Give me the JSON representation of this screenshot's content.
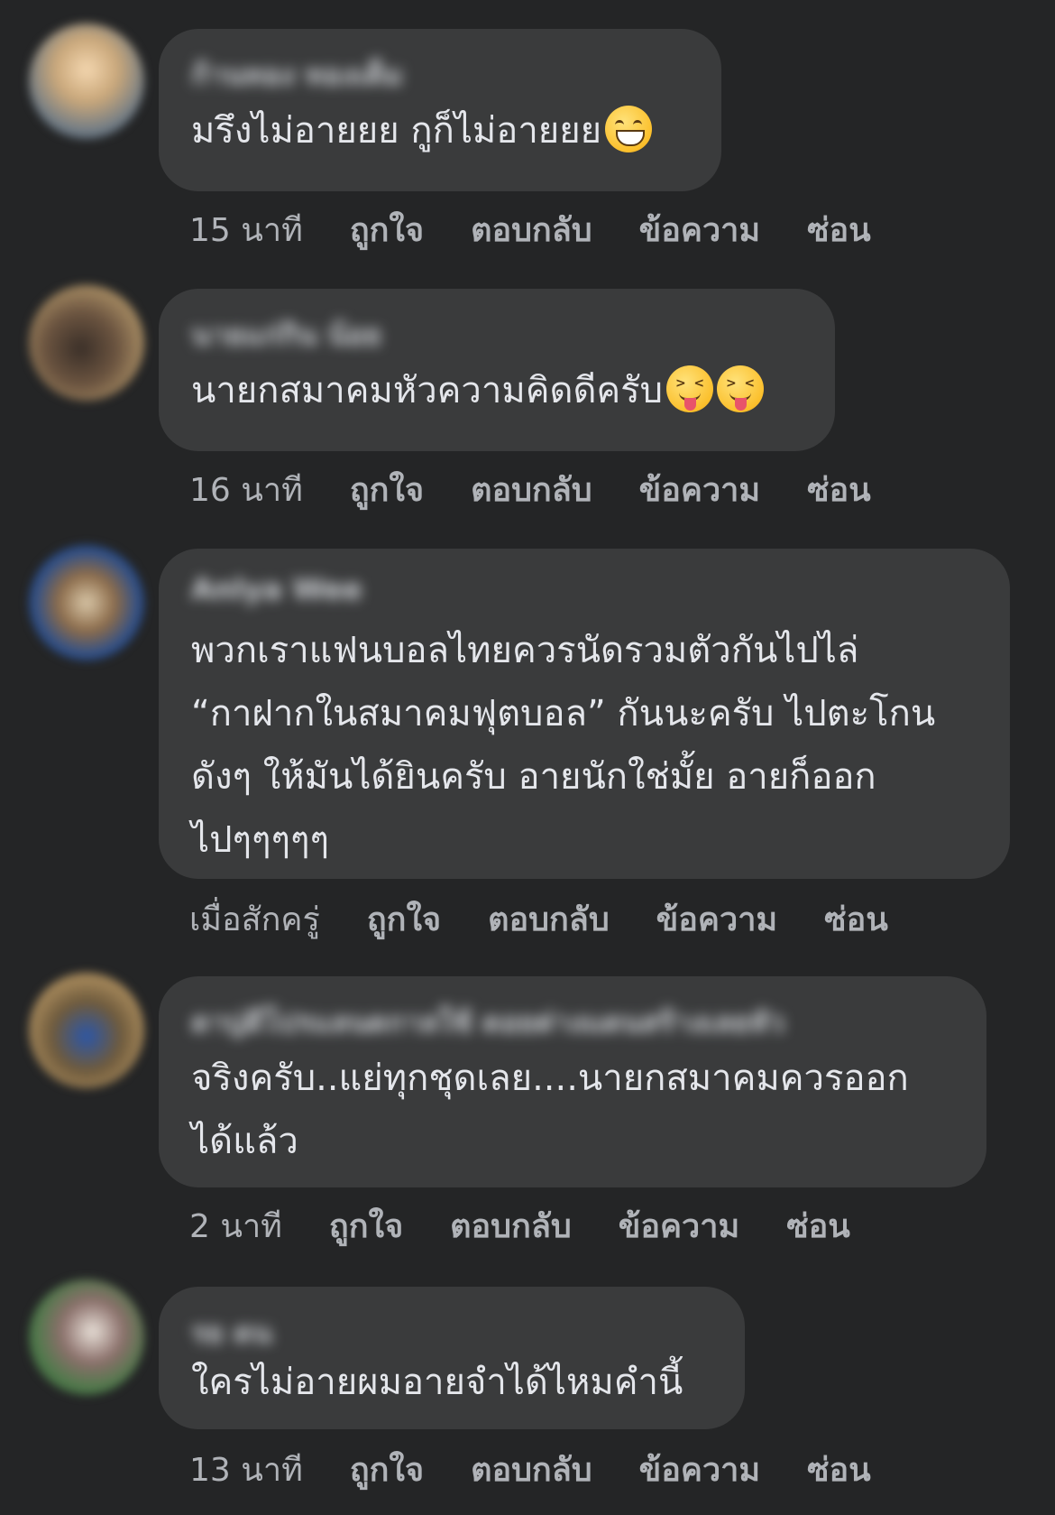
{
  "comments": [
    {
      "author": "ก้านทอง ทองเต็ม",
      "text": "มรึงไม่อายยย กูก็ไม่อายยย",
      "emoji": [
        "grinning-face-with-smiling-eyes"
      ],
      "time": "15 นาที",
      "actions": [
        "ถูกใจ",
        "ตอบกลับ",
        "ข้อความ",
        "ซ่อน"
      ]
    },
    {
      "author": "นายแก่กิน น้อย",
      "text": "นายกสมาคมหัวความคิดดีครับ",
      "emoji": [
        "squinting-face-with-tongue",
        "squinting-face-with-tongue"
      ],
      "time": "16 นาที",
      "actions": [
        "ถูกใจ",
        "ตอบกลับ",
        "ข้อความ",
        "ซ่อน"
      ]
    },
    {
      "author": "Anlya Wee",
      "text": "พวกเราแฟนบอลไทยควรนัดรวมตัวกันไปไล่\n“กาฝากในสมาคมฟุตบอล” กันนะครับ ไปตะโกน\nดังๆ ให้มันได้ยินครับ อายนักใช่มั้ย อายก็ออก\nไปๆๆๆๆๆ",
      "emoji": [],
      "time": "เมื่อสักครู่",
      "actions": [
        "ถูกใจ",
        "ตอบกลับ",
        "ข้อความ",
        "ซ่อน"
      ]
    },
    {
      "author": "ดาบู่ดีโปรแลนดกาลใช้ ดอยต่างแดนสร้างเลยหัว",
      "text": "จริงครับ..แย่ทุกชุดเลย....นายกสมาคมควรออก\nได้แล้ว",
      "emoji": [],
      "time": "2 นาที",
      "actions": [
        "ถูกใจ",
        "ตอบกลับ",
        "ข้อความ",
        "ซ่อน"
      ]
    },
    {
      "author": "รย ดน",
      "text": "ใครไม่อายผมอายจำได้ไหมคำนี้",
      "emoji": [],
      "time": "13 นาที",
      "actions": [
        "ถูกใจ",
        "ตอบกลับ",
        "ข้อความ",
        "ซ่อน"
      ]
    }
  ],
  "colors": {
    "background": "#242526",
    "bubble": "#3a3b3c",
    "primary_text": "#e4e6eb",
    "secondary_text": "#b0b3b8"
  }
}
